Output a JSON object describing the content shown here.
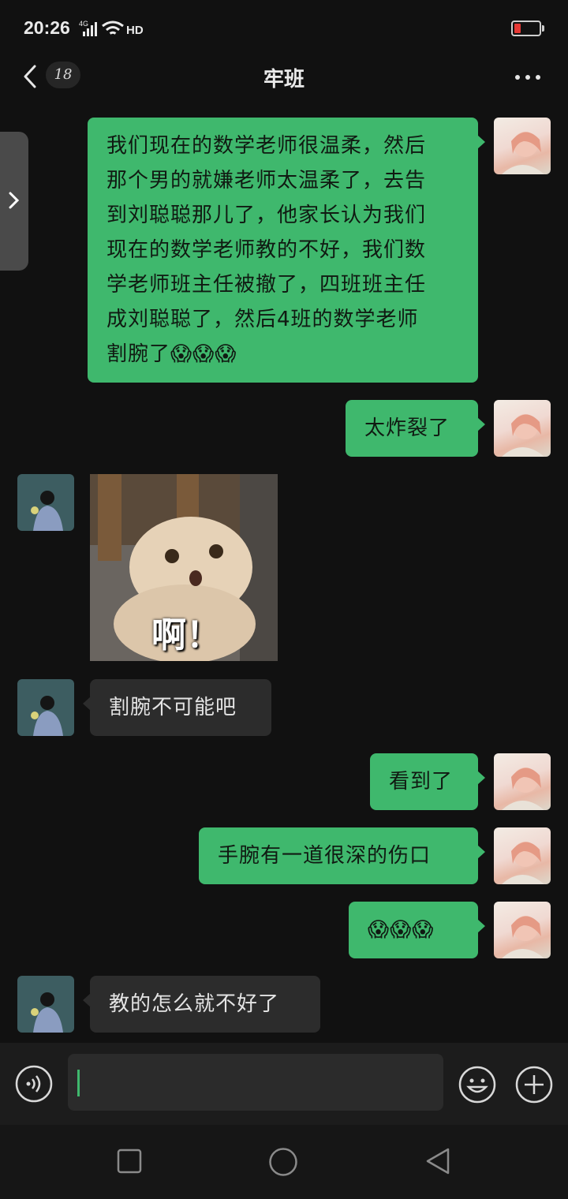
{
  "status_bar": {
    "time": "20:26",
    "network": "4G",
    "hd": "HD",
    "battery_level": 0.15,
    "battery_color": "#e53935"
  },
  "header": {
    "unread_count": "18",
    "title": "牢班"
  },
  "colors": {
    "self_bubble": "#3fb86d",
    "friend_bubble": "#2c2c2c",
    "background": "#111111"
  },
  "messages": [
    {
      "sender": "self",
      "type": "text",
      "lines": [
        "我们现在的数学老师很温柔，然后",
        "那个男的就嫌老师太温柔了，去告",
        "到刘聪聪那儿了，他家长认为我们",
        "现在的数学老师教的不好，我们数",
        "学老师班主任被撤了，四班班主任",
        "成刘聪聪了，然后4班的数学老师",
        "割腕了😱😱😱"
      ]
    },
    {
      "sender": "self",
      "type": "text",
      "text": "太炸裂了"
    },
    {
      "sender": "friend",
      "type": "sticker",
      "caption": "啊！",
      "icon": "scared-cat-sticker"
    },
    {
      "sender": "friend",
      "type": "text",
      "text": "割腕不可能吧"
    },
    {
      "sender": "self",
      "type": "text",
      "text": "看到了"
    },
    {
      "sender": "self",
      "type": "text",
      "text": "手腕有一道很深的伤口"
    },
    {
      "sender": "self",
      "type": "text",
      "text": "😱😱😱"
    },
    {
      "sender": "friend",
      "type": "text",
      "text": "教的怎么就不好了"
    }
  ],
  "input": {
    "value": "",
    "placeholder": ""
  },
  "icons": {
    "back": "chevron-left-icon",
    "more": "more-dots-icon",
    "voice": "voice-icon",
    "emoji": "emoji-icon",
    "add": "plus-icon"
  }
}
